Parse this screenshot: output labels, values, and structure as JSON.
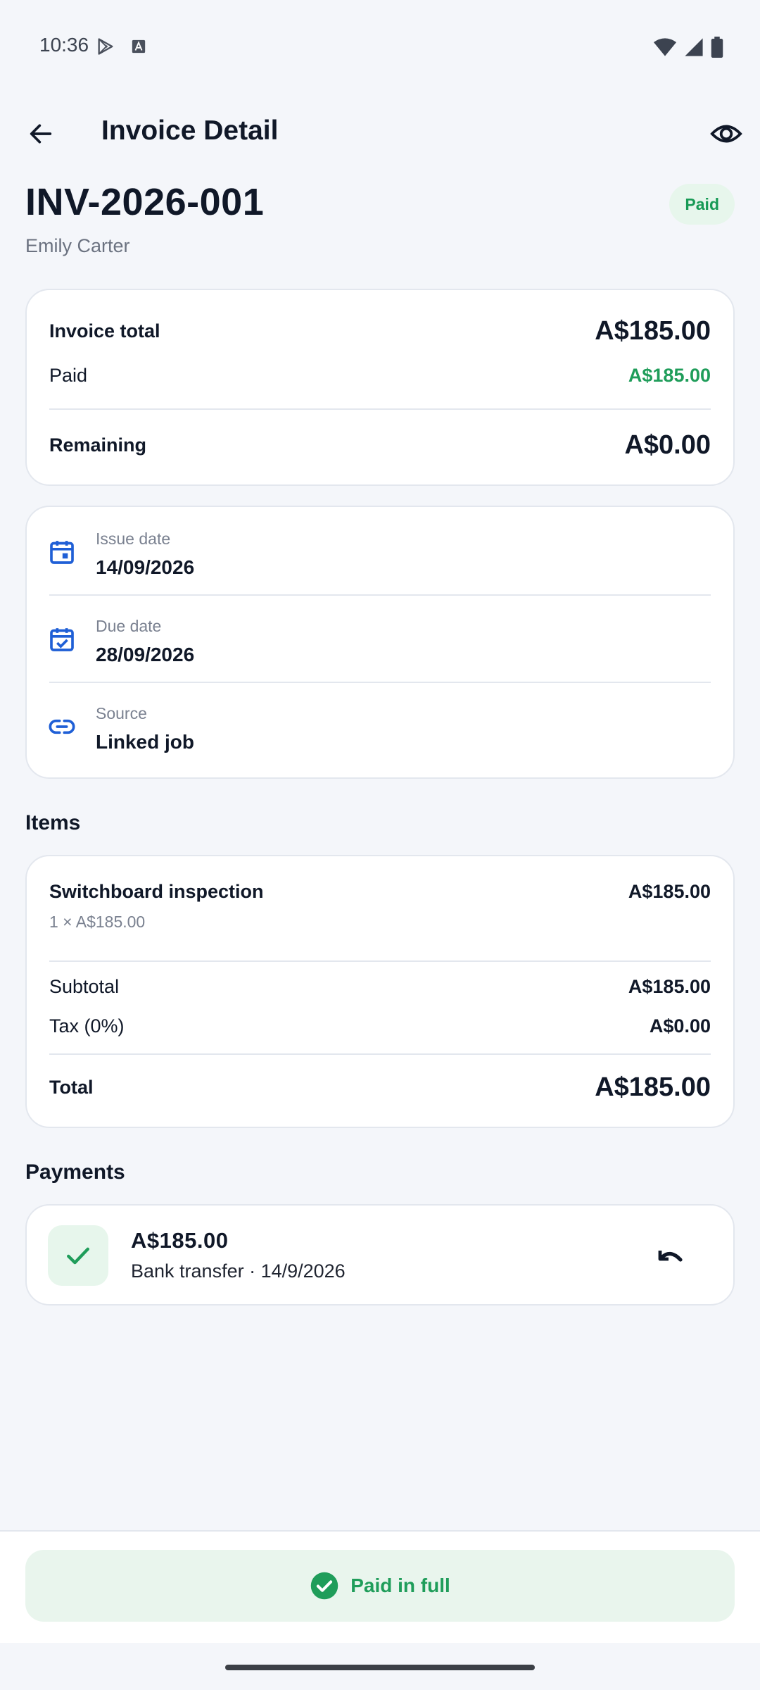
{
  "status_bar": {
    "time": "10:36"
  },
  "app_bar": {
    "title": "Invoice Detail"
  },
  "invoice": {
    "number": "INV-2026-001",
    "client": "Emily Carter",
    "status": "Paid"
  },
  "summary": {
    "total_label": "Invoice total",
    "total_value": "A$185.00",
    "paid_label": "Paid",
    "paid_value": "A$185.00",
    "remaining_label": "Remaining",
    "remaining_value": "A$0.00"
  },
  "details": [
    {
      "label": "Issue date",
      "value": "14/09/2026",
      "icon": "calendar-icon"
    },
    {
      "label": "Due date",
      "value": "28/09/2026",
      "icon": "calendar-check-icon"
    },
    {
      "label": "Source",
      "value": "Linked job",
      "icon": "link-icon"
    }
  ],
  "items_section": {
    "title": "Items",
    "items": [
      {
        "name": "Switchboard inspection",
        "qty_price": "1 × A$185.00",
        "amount": "A$185.00"
      }
    ],
    "subtotal_label": "Subtotal",
    "subtotal_value": "A$185.00",
    "tax_label": "Tax (0%)",
    "tax_value": "A$0.00",
    "total_label": "Total",
    "total_value": "A$185.00"
  },
  "payments_section": {
    "title": "Payments",
    "payments": [
      {
        "amount": "A$185.00",
        "meta": "Bank transfer · 14/9/2026"
      }
    ]
  },
  "bottom": {
    "paid_full_label": "Paid in full"
  },
  "colors": {
    "accent_blue": "#1f5fd6",
    "success_green": "#1f9d5a",
    "badge_bg": "#e7f6ec"
  }
}
